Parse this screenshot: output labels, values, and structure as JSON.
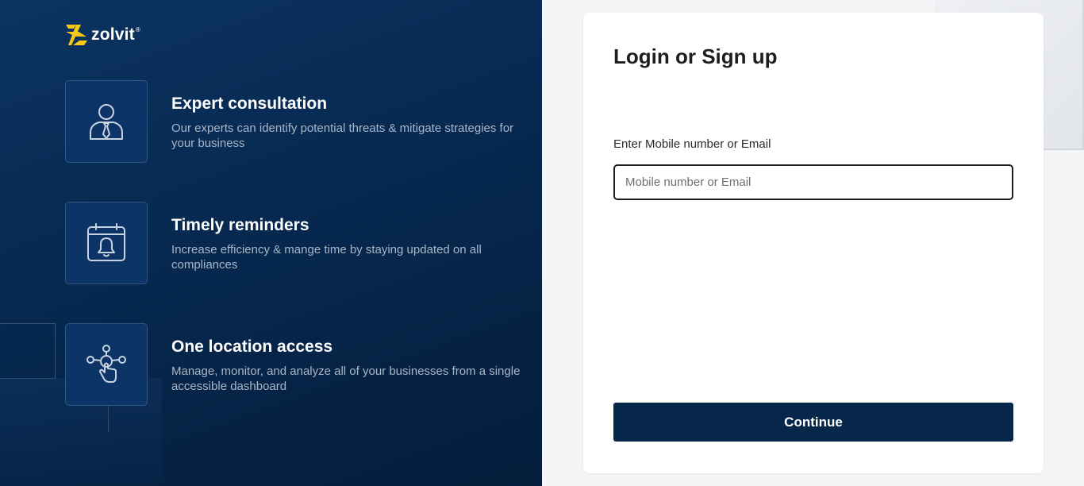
{
  "brand": {
    "name": "zolvit",
    "reg": "®"
  },
  "features": [
    {
      "icon": "expert-person-icon",
      "title": "Expert consultation",
      "description": "Our experts can identify potential threats & mitigate strategies for your business"
    },
    {
      "icon": "calendar-bell-icon",
      "title": "Timely reminders",
      "description": "Increase efficiency & mange time by staying updated on all compliances"
    },
    {
      "icon": "network-touch-icon",
      "title": "One location access",
      "description": "Manage, monitor, and analyze all of your businesses from a single accessible dashboard"
    }
  ],
  "login": {
    "title": "Login or Sign up",
    "field_label": "Enter Mobile number or Email",
    "placeholder": "Mobile number or Email",
    "value": "",
    "continue_label": "Continue"
  },
  "colors": {
    "left_panel": "#072a52",
    "brand_yellow": "#f6c915",
    "button": "#06264a"
  }
}
